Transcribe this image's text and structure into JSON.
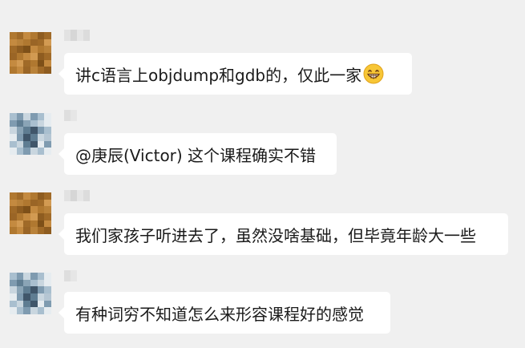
{
  "messages": [
    {
      "sender": "",
      "text": "讲c语言上objdump和gdb的，仅此一家",
      "emoji": "grinning-face-icon",
      "avatar": "brown"
    },
    {
      "sender": "",
      "text": "@庚辰(Victor) 这个课程确实不错",
      "avatar": "blue"
    },
    {
      "sender": "",
      "text": "我们家孩子听进去了，虽然没啥基础，但毕竟年龄大一些",
      "avatar": "brown"
    },
    {
      "sender": "",
      "text": "有种词穷不知道怎么来形容课程好的感觉",
      "avatar": "blue"
    }
  ],
  "colors": {
    "background": "#f0f0f0",
    "bubble": "#ffffff",
    "text": "#1a1a1a"
  }
}
